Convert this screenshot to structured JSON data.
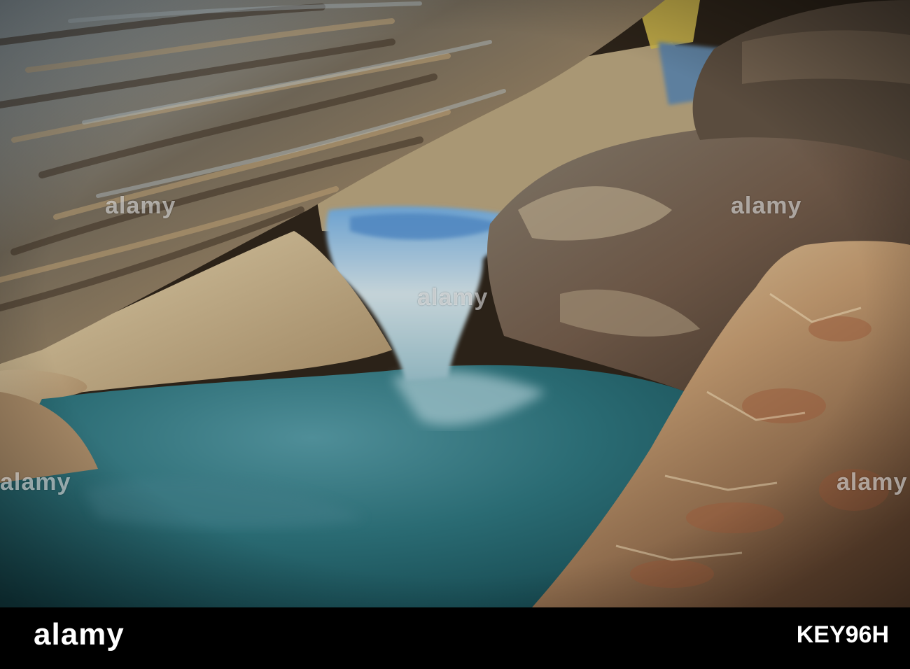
{
  "photo": {
    "subject": "cave-waterfall-pool",
    "watermark": "alamy",
    "colors": {
      "water_deep": "#1f5f66",
      "water_light": "#6fa9b7",
      "rock_light": "#cdb892",
      "rock_warm": "#a8875f",
      "rock_dark": "#3e3226",
      "rock_blue": "#8fa2ad",
      "rust": "#9a5a3a"
    }
  },
  "footer": {
    "logo": "alamy",
    "image_code": "KEY96H"
  }
}
